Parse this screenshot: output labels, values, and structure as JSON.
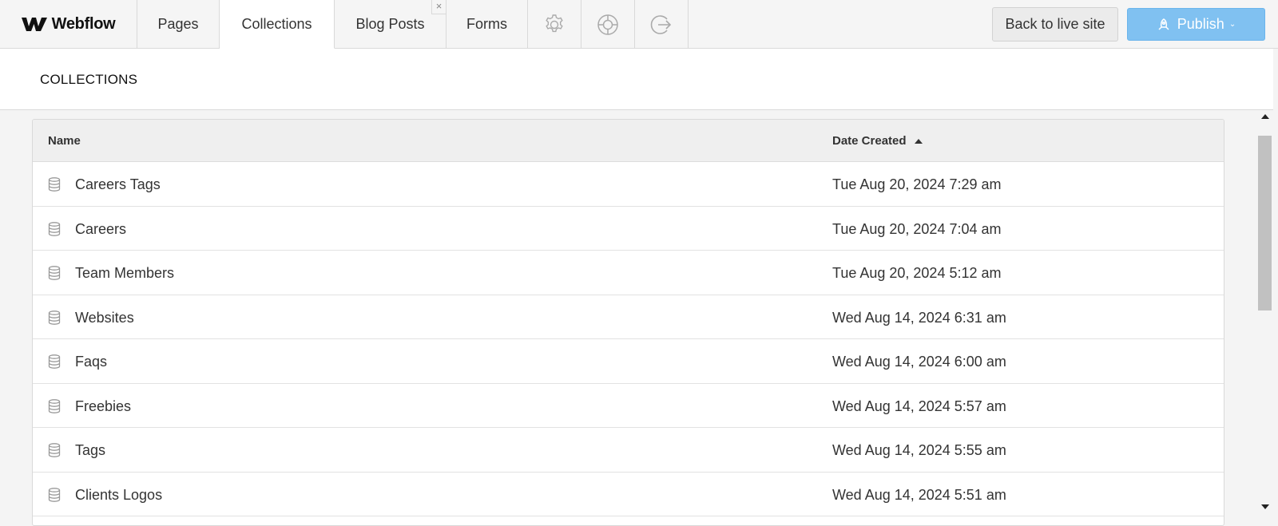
{
  "brand": {
    "name": "Webflow"
  },
  "tabs": [
    {
      "label": "Pages"
    },
    {
      "label": "Collections"
    },
    {
      "label": "Blog Posts",
      "close": "×"
    },
    {
      "label": "Forms"
    }
  ],
  "icon_tabs": [
    "gear-icon",
    "help-lifebuoy-icon",
    "logout-icon"
  ],
  "actions": {
    "back_label": "Back to live site",
    "publish_label": "Publish"
  },
  "section": {
    "title": "COLLECTIONS"
  },
  "table": {
    "columns": {
      "name": "Name",
      "date": "Date Created"
    },
    "sort": "date-ascending",
    "rows": [
      {
        "name": "Careers Tags",
        "date": "Tue Aug 20, 2024 7:29 am"
      },
      {
        "name": "Careers",
        "date": "Tue Aug 20, 2024 7:04 am"
      },
      {
        "name": "Team Members",
        "date": "Tue Aug 20, 2024 5:12 am"
      },
      {
        "name": "Websites",
        "date": "Wed Aug 14, 2024 6:31 am"
      },
      {
        "name": "Faqs",
        "date": "Wed Aug 14, 2024 6:00 am"
      },
      {
        "name": "Freebies",
        "date": "Wed Aug 14, 2024 5:57 am"
      },
      {
        "name": "Tags",
        "date": "Wed Aug 14, 2024 5:55 am"
      },
      {
        "name": "Clients Logos",
        "date": "Wed Aug 14, 2024 5:51 am"
      }
    ]
  },
  "colors": {
    "publish": "#80c1f1",
    "topbar": "#f5f5f5",
    "header_row": "#efefef"
  }
}
